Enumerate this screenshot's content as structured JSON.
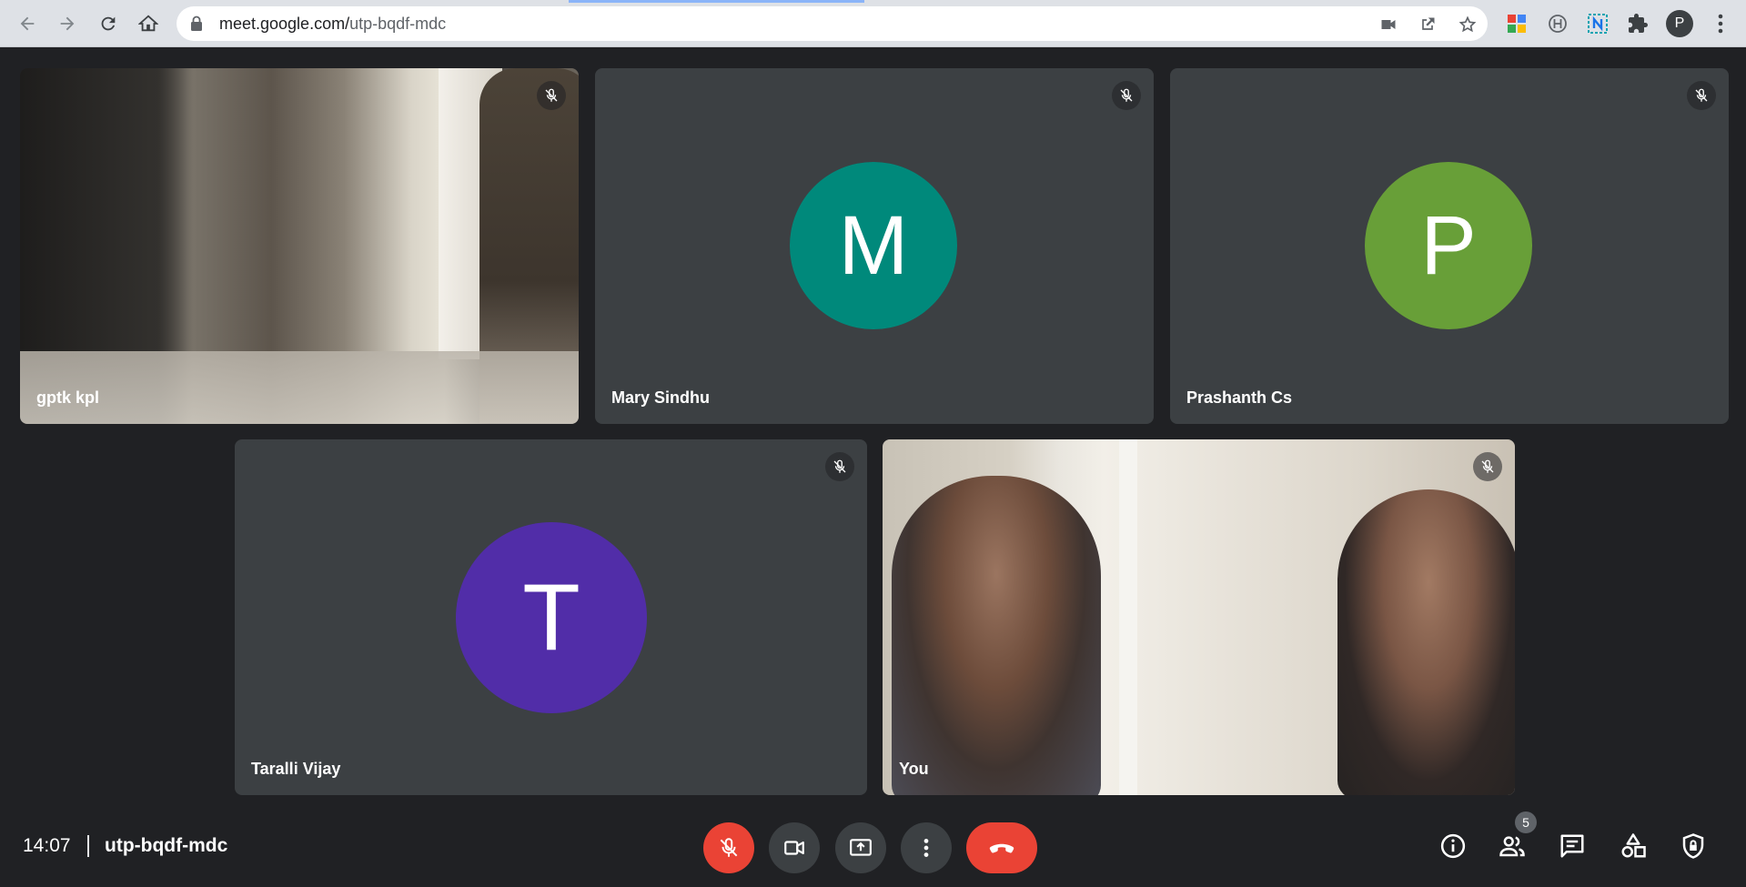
{
  "browser": {
    "url_host": "meet.google.com/",
    "url_path": "utp-bqdf-mdc",
    "profile_initial": "P",
    "icons": [
      "back-icon",
      "forward-icon",
      "reload-icon",
      "home-icon",
      "lock-icon",
      "camera-icon",
      "open-external-icon",
      "star-icon",
      "extension-google-icon",
      "extension-h-icon",
      "extension-n-icon",
      "puzzle-icon",
      "kebab-icon"
    ]
  },
  "participants": [
    {
      "name": "gptk kpl",
      "type": "video",
      "muted": true
    },
    {
      "name": "Mary Sindhu",
      "type": "avatar",
      "initial": "M",
      "color": "#00897b",
      "muted": true
    },
    {
      "name": "Prashanth Cs",
      "type": "avatar",
      "initial": "P",
      "color": "#689f38",
      "muted": true
    },
    {
      "name": "Taralli Vijay",
      "type": "avatar",
      "initial": "T",
      "color": "#512da8",
      "muted": true
    },
    {
      "name": "You",
      "type": "video",
      "muted": true
    }
  ],
  "bottom_bar": {
    "time": "14:07",
    "meeting_code": "utp-bqdf-mdc",
    "people_count": "5"
  },
  "colors": {
    "background": "#202124",
    "tile": "#3c4043",
    "danger": "#ea4335"
  }
}
